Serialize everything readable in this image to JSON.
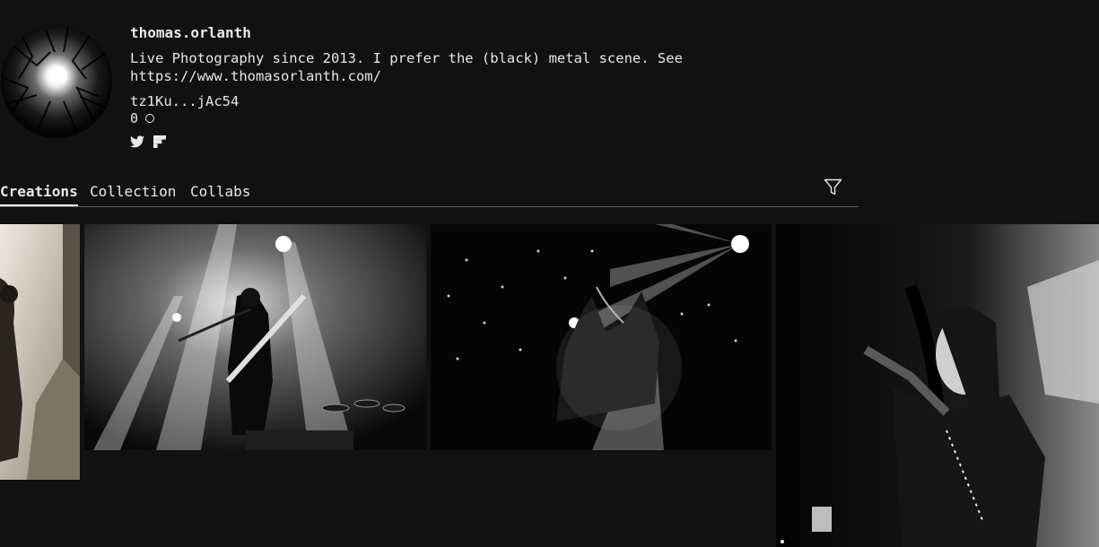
{
  "profile": {
    "username": "thomas.orlanth",
    "bio": "Live Photography since 2013. I prefer the (black) metal scene. See\nhttps://www.thomasorlanth.com/",
    "wallet": "tz1Ku...jAc54",
    "count": "0"
  },
  "socials": [
    {
      "icon": "twitter-icon"
    },
    {
      "icon": "flipboard-icon"
    }
  ],
  "tabs": [
    {
      "label": "Creations",
      "active": true
    },
    {
      "label": "Collection",
      "active": false
    },
    {
      "label": "Collabs",
      "active": false
    }
  ],
  "filter_icon": "filter-icon",
  "colors": {
    "background": "#111111",
    "text": "#e8e8e8",
    "divider": "#5a5a5a"
  }
}
